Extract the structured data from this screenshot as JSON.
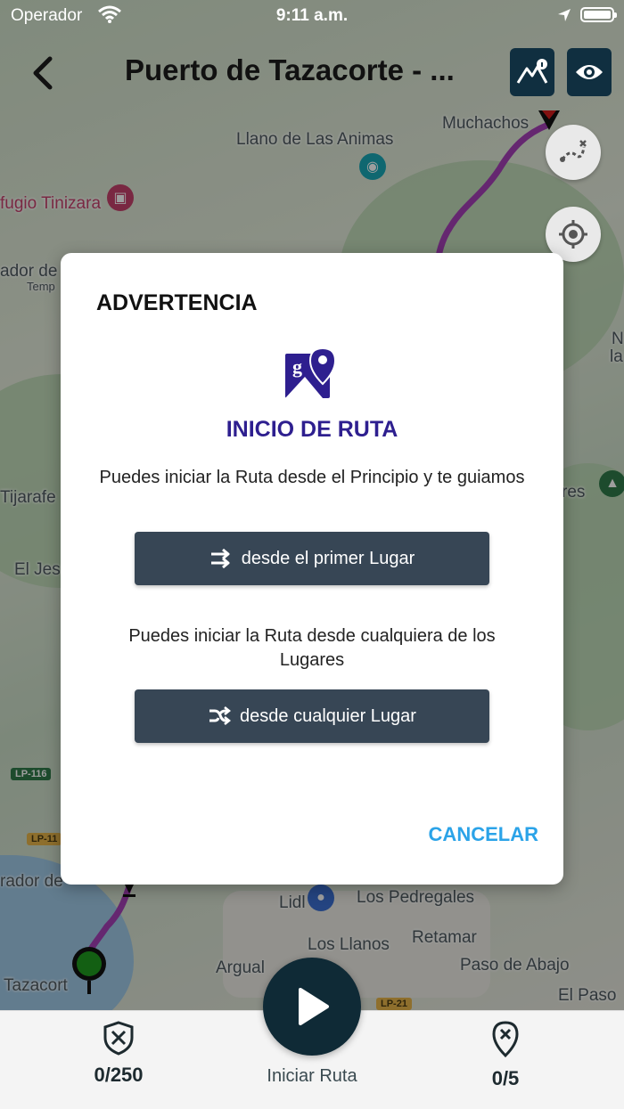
{
  "status_bar": {
    "carrier": "Operador",
    "time": "9:11 a.m."
  },
  "header": {
    "title": "Puerto de Tazacorte - ..."
  },
  "map": {
    "labels": {
      "muchachos": "Muchachos",
      "llano": "Llano de Las Animas",
      "refugio": "fugio Tinizara",
      "mirador_top": "ador de",
      "temp": "Temp",
      "tijarafe": "Tijarafe",
      "el_jes": "El Jes",
      "n_la": "N",
      "la": "la",
      "res": "res",
      "los_pedregales": "Los Pedregales",
      "lidl": "Lidl",
      "los_llanos": "Los Llanos",
      "retamar": "Retamar",
      "paso_de_abajo": "Paso de Abajo",
      "argual": "Argual",
      "el_paso": "El Paso",
      "tazacorte": "Tazacort",
      "mirador_bottom": "rador de"
    },
    "roads": {
      "lp116": "LP-116",
      "lp11": "LP-11",
      "lp21": "LP-21"
    }
  },
  "dialog": {
    "title": "ADVERTENCIA",
    "heading": "INICIO DE RUTA",
    "text_first": "Puedes iniciar la Ruta desde el Principio y te guiamos",
    "button_first": "desde el primer Lugar",
    "text_any": "Puedes iniciar la Ruta desde cualquiera de los Lugares",
    "button_any": "desde cualquier Lugar",
    "cancel": "CANCELAR"
  },
  "bottom_bar": {
    "points": "0/250",
    "play_label": "Iniciar Ruta",
    "places": "0/5"
  },
  "colors": {
    "dialog_heading": "#2e1f8f",
    "dialog_button": "#374655",
    "cancel": "#2ba3e8",
    "route": "#a43fb5",
    "start_marker": "#1f9a1f",
    "header_buttons": "#102f40"
  }
}
